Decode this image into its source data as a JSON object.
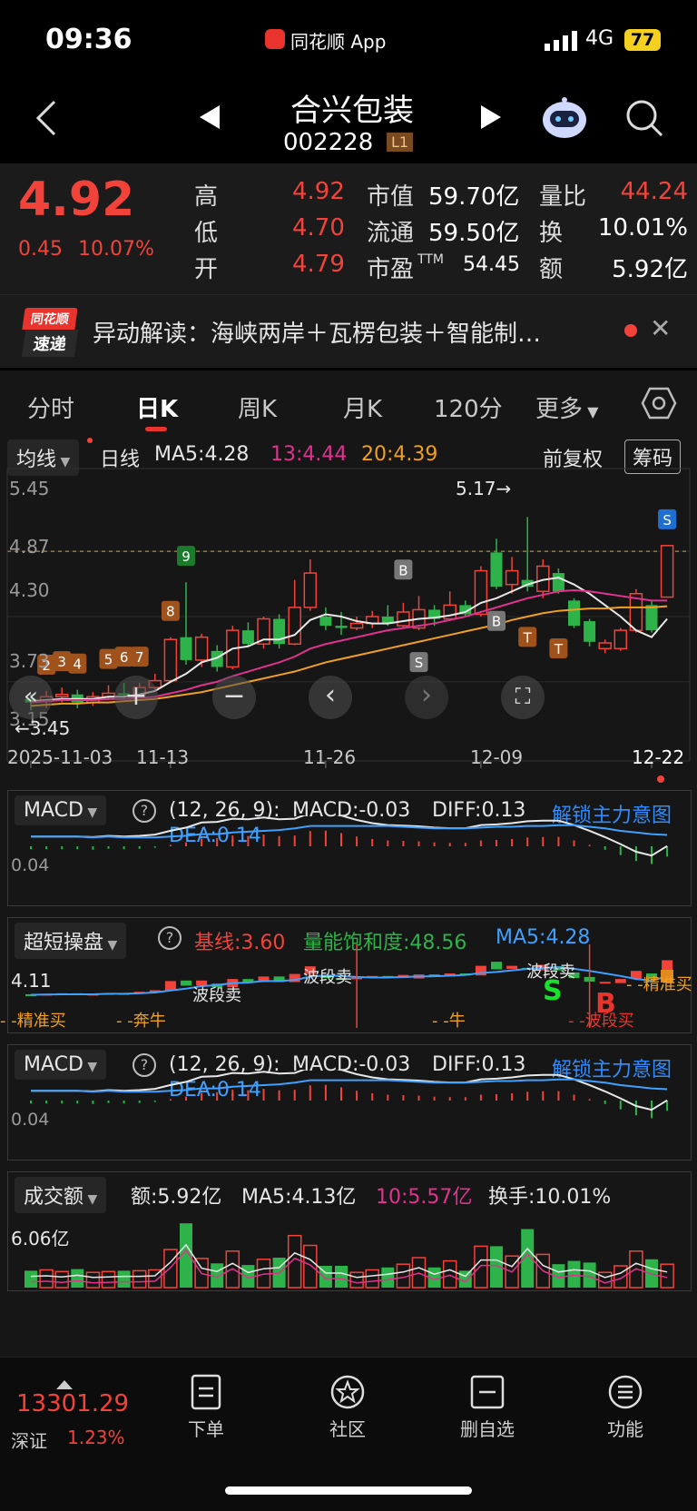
{
  "status_bar": {
    "time": "09:36",
    "app_label": "同花顺 App",
    "network": "4G",
    "battery": "77"
  },
  "header": {
    "stock_name": "合兴包装",
    "stock_code": "002228",
    "level_badge": "L1"
  },
  "quote": {
    "price": "4.92",
    "change": "0.45",
    "change_pct": "10.07%",
    "rows": [
      {
        "l1": "高",
        "v1": "4.92",
        "l2": "市值",
        "v2": "59.70亿",
        "l3": "量比",
        "v3": "44.24"
      },
      {
        "l1": "低",
        "v1": "4.70",
        "l2": "流通",
        "v2": "59.50亿",
        "l3": "换",
        "v3": "10.01%"
      },
      {
        "l1": "开",
        "v1": "4.79",
        "l2": "市盈",
        "v2sup": "TTM",
        "v2": "54.45",
        "l3": "额",
        "v3": "5.92亿"
      }
    ]
  },
  "news": {
    "badge_top": "同花顺",
    "badge_bottom": "速递",
    "text": "异动解读：海峡两岸＋瓦楞包装＋智能制…"
  },
  "tabs": [
    {
      "label": "分时",
      "active": false
    },
    {
      "label": "日K",
      "active": true
    },
    {
      "label": "周K",
      "active": false
    },
    {
      "label": "月K",
      "active": false
    },
    {
      "label": "120分",
      "active": false
    },
    {
      "label": "更多",
      "active": false
    }
  ],
  "kline_header": {
    "ma_select": "均线",
    "period": "日线",
    "ma5": "MA5:4.28",
    "ma13": "13:4.44",
    "ma20": "20:4.39",
    "adjust": "前复权",
    "chips": "筹码"
  },
  "kline_axis": {
    "y_labels": [
      "5.45",
      "4.87",
      "4.30",
      "3.73",
      "3.15"
    ],
    "high_marker": "5.17→",
    "low_marker": "←3.45",
    "x_labels": [
      "2025-11-03",
      "11-13",
      "11-26",
      "12-09",
      "12-22"
    ]
  },
  "chart_data": {
    "type": "candlestick",
    "title": "合兴包装 002228 日K",
    "ylim": [
      3.15,
      5.45
    ],
    "candles": [
      {
        "o": 3.58,
        "c": 3.55,
        "h": 3.62,
        "l": 3.48
      },
      {
        "o": 3.56,
        "c": 3.6,
        "h": 3.65,
        "l": 3.5
      },
      {
        "o": 3.6,
        "c": 3.62,
        "h": 3.68,
        "l": 3.55
      },
      {
        "o": 3.62,
        "c": 3.55,
        "h": 3.66,
        "l": 3.5
      },
      {
        "o": 3.55,
        "c": 3.6,
        "h": 3.64,
        "l": 3.52
      },
      {
        "o": 3.6,
        "c": 3.63,
        "h": 3.7,
        "l": 3.57
      },
      {
        "o": 3.63,
        "c": 3.62,
        "h": 3.72,
        "l": 3.58
      },
      {
        "o": 3.62,
        "c": 3.68,
        "h": 3.72,
        "l": 3.58
      },
      {
        "o": 3.68,
        "c": 3.74,
        "h": 3.8,
        "l": 3.65
      },
      {
        "o": 3.74,
        "c": 4.1,
        "h": 4.12,
        "l": 3.72
      },
      {
        "o": 4.12,
        "c": 3.92,
        "h": 4.6,
        "l": 3.88
      },
      {
        "o": 3.92,
        "c": 4.12,
        "h": 4.15,
        "l": 3.86
      },
      {
        "o": 4.0,
        "c": 3.86,
        "h": 4.05,
        "l": 3.82
      },
      {
        "o": 3.86,
        "c": 4.18,
        "h": 4.22,
        "l": 3.84
      },
      {
        "o": 4.18,
        "c": 4.06,
        "h": 4.25,
        "l": 4.04
      },
      {
        "o": 4.06,
        "c": 4.28,
        "h": 4.3,
        "l": 4.02
      },
      {
        "o": 4.28,
        "c": 4.06,
        "h": 4.32,
        "l": 4.02
      },
      {
        "o": 4.06,
        "c": 4.38,
        "h": 4.62,
        "l": 4.05
      },
      {
        "o": 4.38,
        "c": 4.68,
        "h": 4.8,
        "l": 4.35
      },
      {
        "o": 4.3,
        "c": 4.22,
        "h": 4.38,
        "l": 4.18
      },
      {
        "o": 4.22,
        "c": 4.2,
        "h": 4.34,
        "l": 4.14
      },
      {
        "o": 4.2,
        "c": 4.24,
        "h": 4.3,
        "l": 4.18
      },
      {
        "o": 4.24,
        "c": 4.3,
        "h": 4.35,
        "l": 4.2
      },
      {
        "o": 4.3,
        "c": 4.24,
        "h": 4.4,
        "l": 4.22
      },
      {
        "o": 4.22,
        "c": 4.34,
        "h": 4.42,
        "l": 4.2
      },
      {
        "o": 4.2,
        "c": 4.36,
        "h": 4.48,
        "l": 4.18
      },
      {
        "o": 4.36,
        "c": 4.28,
        "h": 4.4,
        "l": 4.22
      },
      {
        "o": 4.28,
        "c": 4.4,
        "h": 4.52,
        "l": 4.26
      },
      {
        "o": 4.4,
        "c": 4.32,
        "h": 4.44,
        "l": 4.3
      },
      {
        "o": 4.32,
        "c": 4.7,
        "h": 4.74,
        "l": 4.3
      },
      {
        "o": 4.86,
        "c": 4.56,
        "h": 4.98,
        "l": 4.54
      },
      {
        "o": 4.58,
        "c": 4.7,
        "h": 4.82,
        "l": 4.5
      },
      {
        "o": 4.62,
        "c": 4.56,
        "h": 5.17,
        "l": 4.52
      },
      {
        "o": 4.52,
        "c": 4.74,
        "h": 4.8,
        "l": 4.46
      },
      {
        "o": 4.68,
        "c": 4.52,
        "h": 4.72,
        "l": 4.5
      },
      {
        "o": 4.44,
        "c": 4.22,
        "h": 4.46,
        "l": 4.2
      },
      {
        "o": 4.26,
        "c": 4.08,
        "h": 4.28,
        "l": 4.04
      },
      {
        "o": 4.02,
        "c": 4.07,
        "h": 4.1,
        "l": 3.98
      },
      {
        "o": 4.02,
        "c": 4.18,
        "h": 4.2,
        "l": 4.0
      },
      {
        "o": 4.18,
        "c": 4.5,
        "h": 4.54,
        "l": 4.16
      },
      {
        "o": 4.4,
        "c": 4.18,
        "h": 4.44,
        "l": 4.16
      },
      {
        "o": 4.47,
        "c": 4.92,
        "h": 4.92,
        "l": 4.7
      }
    ],
    "ma_series": [
      {
        "name": "MA5",
        "color": "#e8e8e8",
        "values": [
          3.56,
          3.57,
          3.58,
          3.58,
          3.58,
          3.6,
          3.6,
          3.62,
          3.65,
          3.73,
          3.8,
          3.9,
          3.94,
          4.02,
          4.04,
          4.1,
          4.1,
          4.14,
          4.27,
          4.32,
          4.3,
          4.26,
          4.24,
          4.24,
          4.26,
          4.28,
          4.29,
          4.31,
          4.34,
          4.42,
          4.46,
          4.52,
          4.58,
          4.62,
          4.64,
          4.58,
          4.5,
          4.4,
          4.3,
          4.18,
          4.12,
          4.28
        ]
      },
      {
        "name": "13",
        "color": "#e0338f",
        "values": [
          3.55,
          3.56,
          3.57,
          3.57,
          3.57,
          3.58,
          3.58,
          3.59,
          3.6,
          3.63,
          3.66,
          3.7,
          3.73,
          3.78,
          3.82,
          3.86,
          3.9,
          3.95,
          4.02,
          4.06,
          4.09,
          4.12,
          4.15,
          4.18,
          4.2,
          4.22,
          4.24,
          4.27,
          4.3,
          4.34,
          4.38,
          4.42,
          4.46,
          4.49,
          4.52,
          4.53,
          4.52,
          4.5,
          4.48,
          4.46,
          4.44,
          4.44
        ]
      },
      {
        "name": "20",
        "color": "#f0a020",
        "values": [
          3.52,
          3.53,
          3.54,
          3.54,
          3.55,
          3.55,
          3.56,
          3.57,
          3.58,
          3.6,
          3.62,
          3.64,
          3.67,
          3.7,
          3.73,
          3.76,
          3.79,
          3.82,
          3.86,
          3.9,
          3.93,
          3.96,
          3.99,
          4.02,
          4.05,
          4.08,
          4.11,
          4.14,
          4.17,
          4.2,
          4.23,
          4.27,
          4.3,
          4.33,
          4.35,
          4.36,
          4.37,
          4.37,
          4.38,
          4.38,
          4.38,
          4.39
        ]
      }
    ]
  },
  "chart_controls": [
    "«",
    "+",
    "−",
    "‹",
    "›",
    "⛶"
  ],
  "macd_panel": {
    "select": "MACD",
    "params": "(12, 26, 9):",
    "macd": "MACD:-0.03",
    "diff": "DIFF:0.13",
    "dea": "DEA:0.14",
    "unlock": "解锁主力意图",
    "y_label": "0.04"
  },
  "super_panel": {
    "select": "超短操盘",
    "baseline": "基线:3.60",
    "saturation": "量能饱和度:48.56",
    "ma5": "MA5:4.28",
    "y_label": "4.11",
    "signals": [
      "精准买",
      "奔牛",
      "波段卖",
      "波段卖",
      "牛",
      "波段卖",
      "精准买",
      "波段买"
    ]
  },
  "macd_panel2": {
    "select": "MACD",
    "params": "(12, 26, 9):",
    "macd": "MACD:-0.03",
    "diff": "DIFF:0.13",
    "dea": "DEA:0.14",
    "unlock": "解锁主力意图",
    "y_label": "0.04"
  },
  "volume_panel": {
    "select": "成交额",
    "amount": "额:5.92亿",
    "ma5": "MA5:4.13亿",
    "ma10": "10:5.57亿",
    "turnover": "换手:10.01%",
    "y_label": "6.06亿"
  },
  "bottom_nav": {
    "index_value": "13301.29",
    "index_name": "深证",
    "index_pct": "1.23%",
    "items": [
      "下单",
      "社区",
      "删自选",
      "功能"
    ]
  },
  "colors": {
    "up": "#f2433b",
    "down": "#2db34a",
    "accent": "#1e88ff",
    "bg": "#161616"
  }
}
